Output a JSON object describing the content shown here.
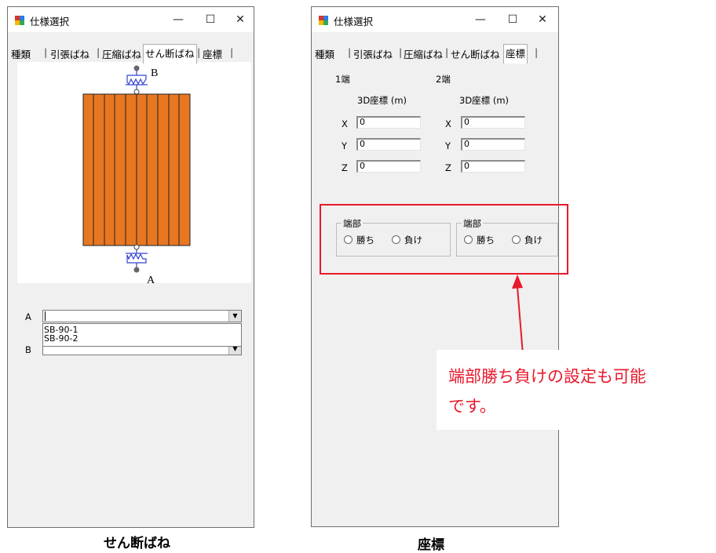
{
  "left_window": {
    "title": "仕様選択",
    "controls": {
      "minimize": "—",
      "maximize": "☐",
      "close": "✕"
    },
    "tabs": [
      {
        "label": "種類",
        "active": false
      },
      {
        "label": "引張ばね",
        "active": false
      },
      {
        "label": "圧縮ばね",
        "active": false
      },
      {
        "label": "せん断ばね",
        "active": true
      },
      {
        "label": "座標",
        "active": false
      }
    ],
    "diagram": {
      "label_top": "B",
      "label_bottom": "A",
      "body_color": "#e87722",
      "spring_color": "#3344cc"
    },
    "field_a_label": "A",
    "field_b_label": "B",
    "dropdown_options": [
      "SB-90-1",
      "SB-90-2"
    ]
  },
  "right_window": {
    "title": "仕様選択",
    "controls": {
      "minimize": "—",
      "maximize": "☐",
      "close": "✕"
    },
    "tabs": [
      {
        "label": "種類",
        "active": false
      },
      {
        "label": "引張ばね",
        "active": false
      },
      {
        "label": "圧縮ばね",
        "active": false
      },
      {
        "label": "せん断ばね",
        "active": false
      },
      {
        "label": "座標",
        "active": true
      }
    ],
    "end1": {
      "title": "1端",
      "subtitle": "3D座標 (m)",
      "x_label": "X",
      "x": "0",
      "y_label": "Y",
      "y": "0",
      "z_label": "Z",
      "z": "0"
    },
    "end2": {
      "title": "2端",
      "subtitle": "3D座標 (m)",
      "x_label": "X",
      "x": "0",
      "y_label": "Y",
      "y": "0",
      "z_label": "Z",
      "z": "0"
    },
    "group1": {
      "title": "端部",
      "win": "勝ち",
      "lose": "負け"
    },
    "group2": {
      "title": "端部",
      "win": "勝ち",
      "lose": "負け"
    }
  },
  "annotation": {
    "line1": "端部勝ち負けの設定も可能",
    "line2": "です。",
    "color": "#e8192c"
  },
  "captions": {
    "left": "せん断ばね",
    "right": "座標"
  }
}
